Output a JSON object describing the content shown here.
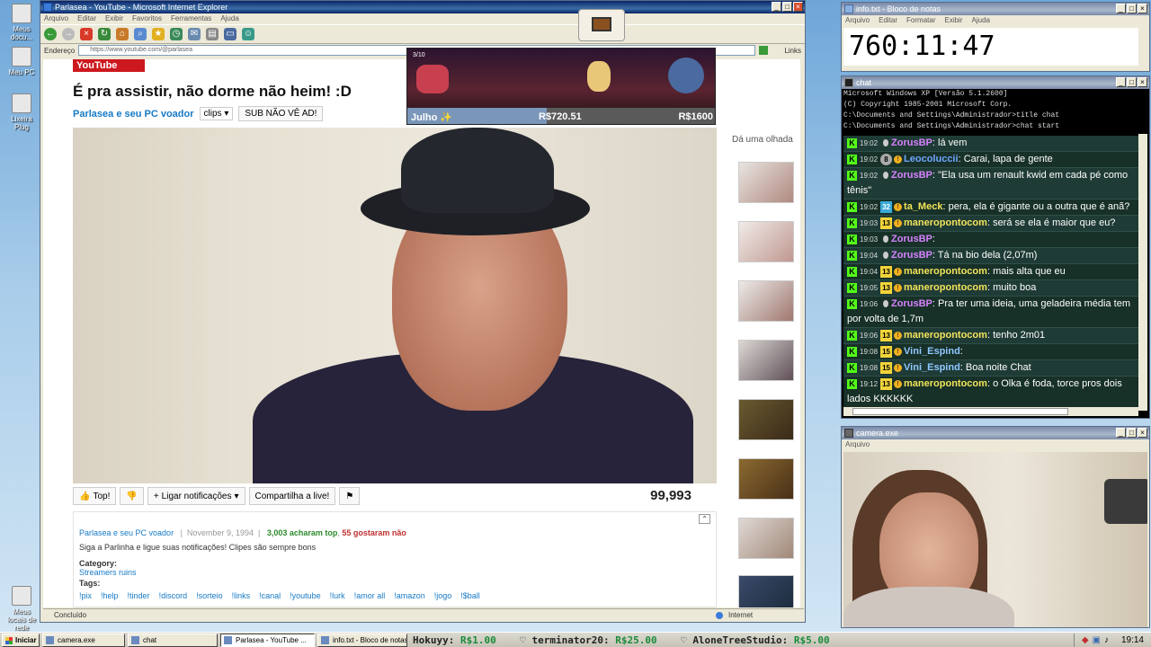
{
  "desktop_icons": [
    "Meus docu...",
    "Meu PC",
    "Lixeira Plug",
    "Meus locais de rede"
  ],
  "browser": {
    "title": "Parlasea - YouTube - Microsoft Internet Explorer",
    "menu": [
      "Arquivo",
      "Editar",
      "Exibir",
      "Favoritos",
      "Ferramentas",
      "Ajuda"
    ],
    "address_label": "Endereço",
    "url": "https://www.youtube.com/@parlasea",
    "links_label": "Links",
    "status_text": "Concluído",
    "status_zone": "Internet"
  },
  "youtube": {
    "logo": "YouTube",
    "video_title": "É pra assistir, não dorme não heim! :D",
    "channel": "Parlasea e seu PC voador",
    "playlist_select": "clips",
    "subscribe_label": "SUB NÃO VÊ AD!",
    "actions": {
      "like": "Top!",
      "notify": "Ligar notificações",
      "share": "Compartilha a live!"
    },
    "views": "99,993",
    "sidebar_label": "Dá uma olhada",
    "description": {
      "channel": "Parlasea e seu PC voador",
      "date": "November 9, 1994",
      "likes": "3,003 acharam top",
      "dislikes": "55 gostaram não",
      "text": "Siga a Parlinha e ligue suas notificações! Clipes são sempre bons",
      "category_label": "Category:",
      "category": "Streamers ruins",
      "tags_label": "Tags:",
      "tags": [
        "!pix",
        "!help",
        "!tinder",
        "!discord",
        "!sorteio",
        "!links",
        "!canal",
        "!youtube",
        "!lurk",
        "!amor all",
        "!amazon",
        "!jogo",
        "!$ball"
      ]
    }
  },
  "game_overlay": {
    "hp_text": "3/10",
    "month": "Julho ✨",
    "current": "R$720.51",
    "goal": "R$1600",
    "progress": 0.45
  },
  "notepad": {
    "title": "info.txt - Bloco de notas",
    "menu": [
      "Arquivo",
      "Editar",
      "Formatar",
      "Exibir",
      "Ajuda"
    ],
    "content": "760:11:47"
  },
  "chat_window": {
    "title": "chat",
    "cmd_lines": [
      "Microsoft Windows XP [Versão 5.1.2600]",
      "(C) Copyright 1985-2001 Microsoft Corp.",
      "",
      "C:\\Documents and Settings\\Administrador>title chat",
      "",
      "C:\\Documents and Settings\\Administrador>chat start"
    ],
    "messages": [
      {
        "time": "19:02",
        "badge": "",
        "user": "ZorusBP",
        "color": "#d782ff",
        "text": "lá vem"
      },
      {
        "time": "19:02",
        "badge": "8",
        "user": "Leocoluccii",
        "color": "#6fa8ff",
        "text": "Carai, lapa de gente"
      },
      {
        "time": "19:02",
        "badge": "",
        "user": "ZorusBP",
        "color": "#d782ff",
        "text": "\"Ela usa um renault kwid em cada pé como tênis\""
      },
      {
        "time": "19:02",
        "badge": "32",
        "user": "ta_Meck",
        "color": "#f2e45a",
        "text": "pera, ela é gigante ou a outra que é anã?"
      },
      {
        "time": "19:03",
        "badge": "13",
        "user": "maneropontocom",
        "color": "#f2e45a",
        "text": "será se ela é maior que eu?"
      },
      {
        "time": "19:03",
        "badge": "",
        "user": "ZorusBP",
        "color": "#d782ff",
        "text": ""
      },
      {
        "time": "19:04",
        "badge": "",
        "user": "ZorusBP",
        "color": "#d782ff",
        "text": "Tá na bio dela (2,07m)"
      },
      {
        "time": "19:04",
        "badge": "13",
        "user": "maneropontocom",
        "color": "#f2e45a",
        "text": "mais alta que eu"
      },
      {
        "time": "19:05",
        "badge": "13",
        "user": "maneropontocom",
        "color": "#f2e45a",
        "text": "muito boa"
      },
      {
        "time": "19:06",
        "badge": "",
        "user": "ZorusBP",
        "color": "#d782ff",
        "text": "Pra ter uma ideia, uma geladeira média tem por volta de 1,7m"
      },
      {
        "time": "19:06",
        "badge": "13",
        "user": "maneropontocom",
        "color": "#f2e45a",
        "text": "tenho 2m01"
      },
      {
        "time": "19:08",
        "badge": "15",
        "user": "Vini_Espind",
        "color": "#8ec8ff",
        "text": ""
      },
      {
        "time": "19:08",
        "badge": "15",
        "user": "Vini_Espind",
        "color": "#8ec8ff",
        "text": "Boa noite Chat"
      },
      {
        "time": "19:12",
        "badge": "13",
        "user": "maneropontocom",
        "color": "#f2e45a",
        "text": "o Olka é foda, torce pros dois lados KKKKKK"
      }
    ]
  },
  "camera": {
    "title": "camera.exe",
    "menu": [
      "Arquivo"
    ]
  },
  "taskbar": {
    "start": "Iniciar",
    "buttons": [
      "camera.exe",
      "chat",
      "Parlasea - YouTube ...",
      "info.txt - Bloco de notas"
    ],
    "ticker": [
      {
        "user": "Hokuyy:",
        "amount": "R$1.00"
      },
      {
        "user": "terminator20:",
        "amount": "R$25.00"
      },
      {
        "user": "AloneTreeStudio:",
        "amount": "R$5.00"
      }
    ],
    "clock": "19:14"
  }
}
